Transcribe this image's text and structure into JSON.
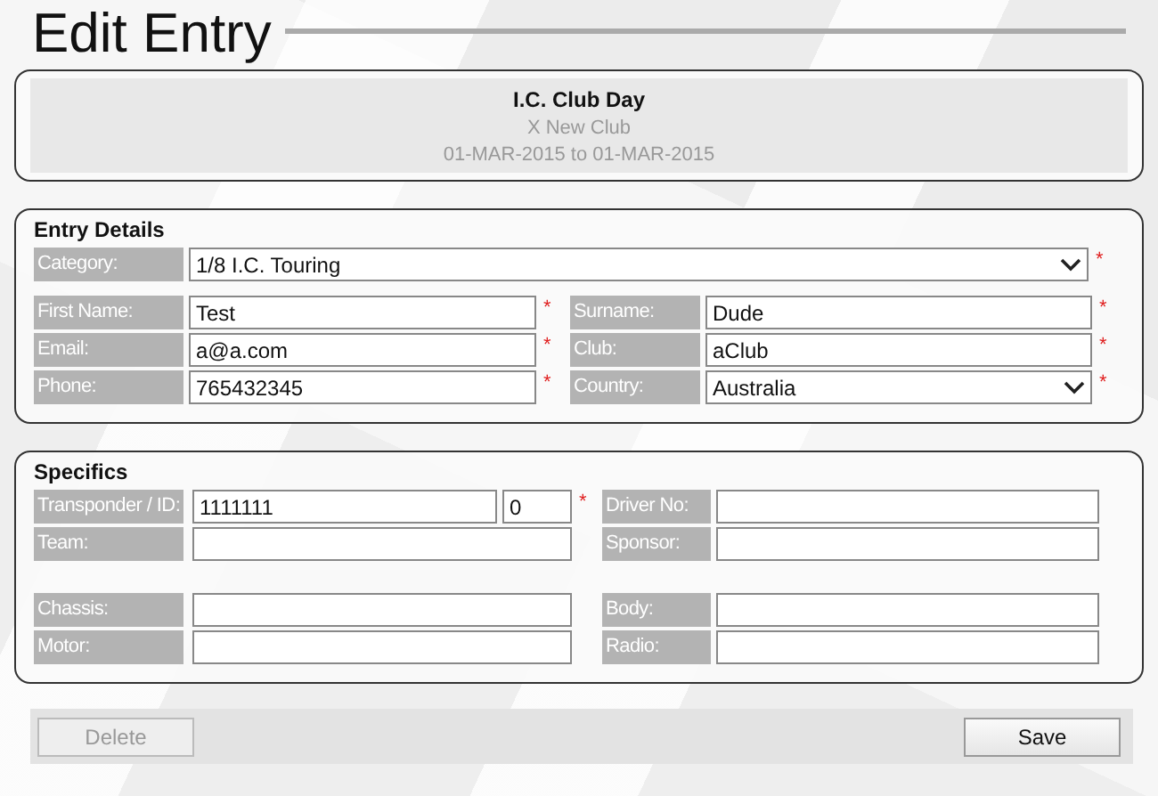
{
  "page": {
    "title": "Edit Entry"
  },
  "event": {
    "name": "I.C. Club Day",
    "club": "X New Club",
    "dates": "01-MAR-2015 to 01-MAR-2015"
  },
  "entry_details": {
    "heading": "Entry Details",
    "category": {
      "label": "Category:",
      "kind": "select",
      "value": "1/8 I.C. Touring",
      "required_mark": "*"
    },
    "rows": [
      [
        {
          "label": "First Name:",
          "kind": "text",
          "value": "Test",
          "required_mark": "*"
        },
        {
          "label": "Surname:",
          "kind": "text",
          "value": "Dude",
          "required_mark": "*"
        }
      ],
      [
        {
          "label": "Email:",
          "kind": "text",
          "value": "a@a.com",
          "required_mark": "*"
        },
        {
          "label": "Club:",
          "kind": "text",
          "value": "aClub",
          "required_mark": "*"
        }
      ],
      [
        {
          "label": "Phone:",
          "kind": "text",
          "value": "765432345",
          "required_mark": "*"
        },
        {
          "label": "Country:",
          "kind": "select",
          "value": "Australia",
          "required_mark": "*"
        }
      ]
    ]
  },
  "specifics": {
    "heading": "Specifics",
    "groups": [
      [
        [
          {
            "label": "Transponder / ID:",
            "kind": "pair",
            "value": "1111111",
            "second_value": "0",
            "required_mark": "*"
          },
          {
            "label": "Driver No:",
            "kind": "text"
          }
        ],
        [
          {
            "label": "Team:",
            "kind": "text"
          },
          {
            "label": "Sponsor:",
            "kind": "text"
          }
        ]
      ],
      [
        [
          {
            "label": "Chassis:",
            "kind": "text"
          },
          {
            "label": "Body:",
            "kind": "text"
          }
        ],
        [
          {
            "label": "Motor:",
            "kind": "text"
          },
          {
            "label": "Radio:",
            "kind": "text"
          }
        ]
      ]
    ]
  },
  "buttons": [
    {
      "label": "Delete",
      "disabled": true
    },
    {
      "label": "Save",
      "disabled": false
    }
  ]
}
